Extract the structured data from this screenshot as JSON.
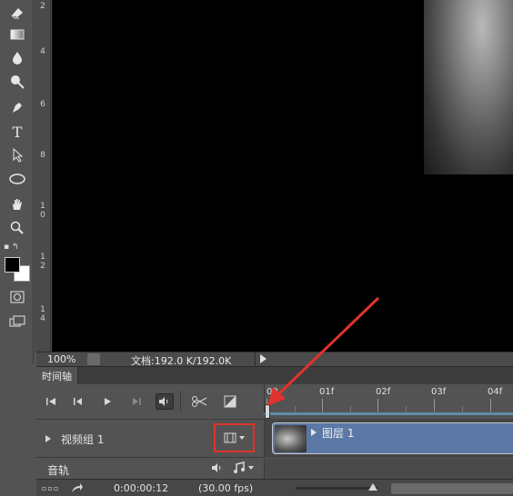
{
  "tools": [
    {
      "name": "eraser-tool"
    },
    {
      "name": "gradient-tool"
    },
    {
      "name": "blur-tool"
    },
    {
      "name": "dodge-tool"
    },
    {
      "name": "pen-tool"
    },
    {
      "name": "type-tool",
      "glyph": "T"
    },
    {
      "name": "path-selection-tool"
    },
    {
      "name": "ellipse-tool"
    },
    {
      "name": "hand-tool"
    },
    {
      "name": "zoom-tool"
    },
    {
      "name": "quick-mask-tool"
    },
    {
      "name": "screen-mode-tool"
    }
  ],
  "colors": {
    "foreground": "#000000",
    "background": "#ffffff",
    "accent_red": "#e0332d",
    "clip_blue": "#5b78a6"
  },
  "vertical_ruler": {
    "labels": [
      "2",
      "4",
      "6",
      "8",
      "1\n0",
      "1\n2",
      "1\n4"
    ]
  },
  "status": {
    "zoom": "100%",
    "document_info": "文档:192.0 K/192.0K"
  },
  "timeline": {
    "tab_label": "时间轴",
    "ruler_labels": [
      "00",
      "01f",
      "02f",
      "03f",
      "04f"
    ],
    "video_group_label": "视频组 1",
    "clip_label": "图层 1",
    "audio_track_label": "音轨",
    "current_time": "0:00:00:12",
    "frame_rate": "(30.00 fps)"
  }
}
